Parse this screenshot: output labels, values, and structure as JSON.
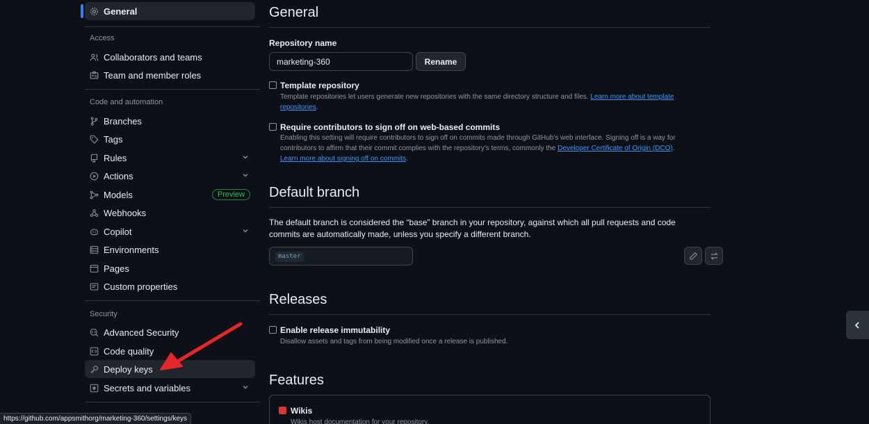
{
  "sidebar": {
    "general": "General",
    "access_label": "Access",
    "collaborators": "Collaborators and teams",
    "team_roles": "Team and member roles",
    "code_automation_label": "Code and automation",
    "branches": "Branches",
    "tags": "Tags",
    "rules": "Rules",
    "actions": "Actions",
    "models": "Models",
    "models_badge": "Preview",
    "webhooks": "Webhooks",
    "copilot": "Copilot",
    "environments": "Environments",
    "pages": "Pages",
    "custom_properties": "Custom properties",
    "security_label": "Security",
    "advanced_security": "Advanced Security",
    "code_quality": "Code quality",
    "deploy_keys": "Deploy keys",
    "secrets_variables": "Secrets and variables"
  },
  "main": {
    "general_title": "General",
    "repo_name_label": "Repository name",
    "repo_name_value": "marketing-360",
    "rename_button": "Rename",
    "template": {
      "title": "Template repository",
      "desc": "Template repositories let users generate new repositories with the same directory structure and files. ",
      "link": "Learn more about template repositories"
    },
    "signoff": {
      "title": "Require contributors to sign off on web-based commits",
      "desc": "Enabling this setting will require contributors to sign off on commits made through GitHub's web interface. Signing off is a way for contributors to affirm that their commit complies with the repository's terms, commonly the ",
      "link1": "Developer Certificate of Origin (DCO)",
      "link2": "Learn more about signing off on commits"
    },
    "default_branch_title": "Default branch",
    "default_branch_desc": "The default branch is considered the “base” branch in your repository, against which all pull requests and code commits are automatically made, unless you specify a different branch.",
    "default_branch_value": "master",
    "releases_title": "Releases",
    "immutability": {
      "title": "Enable release immutability",
      "desc": "Disallow assets and tags from being modified once a release is published."
    },
    "features_title": "Features",
    "wikis": {
      "title": "Wikis",
      "desc": "Wikis host documentation for your repository."
    }
  },
  "status_url": "https://github.com/appsmithorg/marketing-360/settings/keys",
  "colors": {
    "background": "#0d1117",
    "accent": "#2f81f7",
    "link": "#4493f8",
    "preview_badge": "#3fb950",
    "annotation_arrow": "#e5262a"
  }
}
